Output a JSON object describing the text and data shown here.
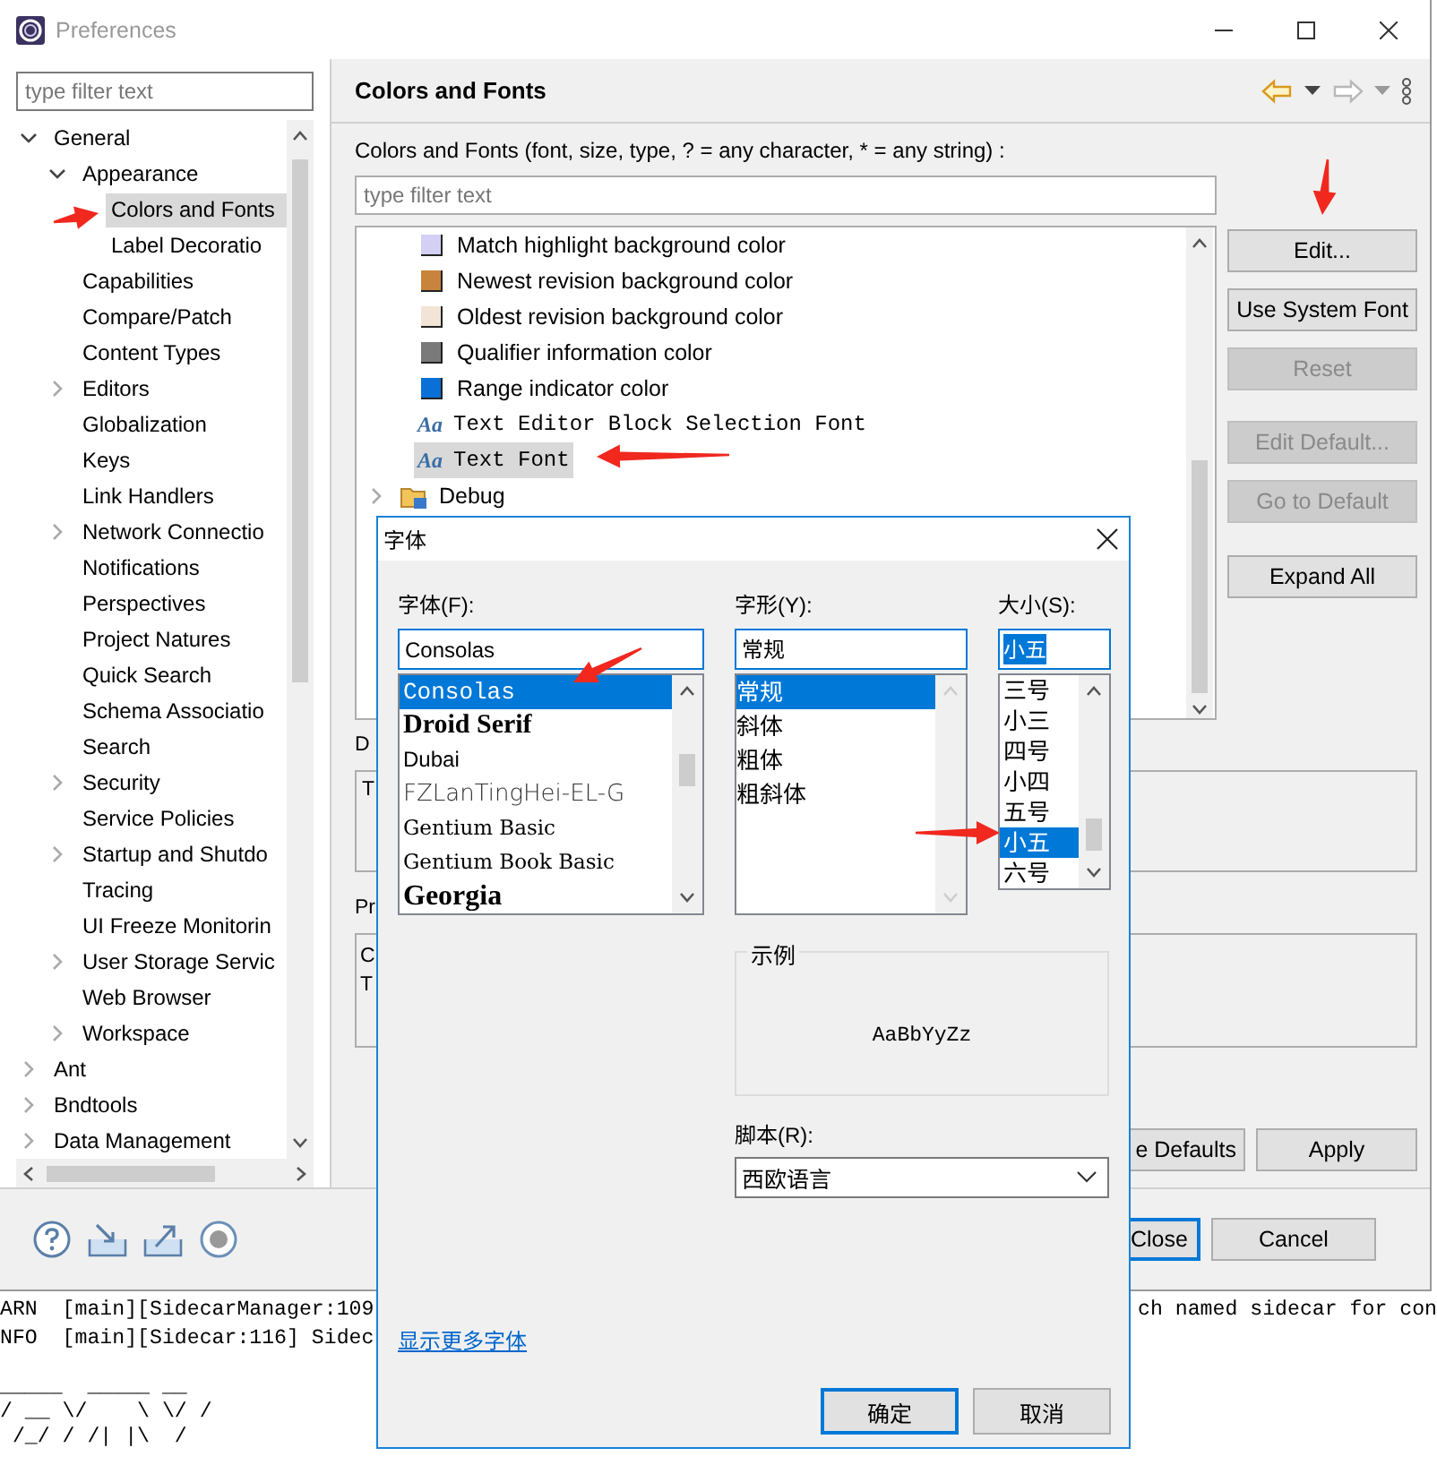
{
  "window": {
    "title": "Preferences"
  },
  "sidebar": {
    "filter": {
      "placeholder": "type filter text"
    },
    "tree": [
      {
        "label": "General",
        "expanded": true,
        "selected": false,
        "children": [
          {
            "label": "Appearance",
            "expanded": true,
            "selected": false,
            "children": [
              {
                "label": "Colors and Fonts",
                "selected": true
              },
              {
                "label": "Label Decoratio",
                "selected": false
              }
            ]
          },
          {
            "label": "Capabilities",
            "selected": false
          },
          {
            "label": "Compare/Patch",
            "selected": false
          },
          {
            "label": "Content Types",
            "selected": false
          },
          {
            "label": "Editors",
            "expanded": false,
            "selected": false
          },
          {
            "label": "Globalization",
            "selected": false
          },
          {
            "label": "Keys",
            "selected": false
          },
          {
            "label": "Link Handlers",
            "selected": false
          },
          {
            "label": "Network Connectio",
            "expanded": false,
            "selected": false
          },
          {
            "label": "Notifications",
            "selected": false
          },
          {
            "label": "Perspectives",
            "selected": false
          },
          {
            "label": "Project Natures",
            "selected": false
          },
          {
            "label": "Quick Search",
            "selected": false
          },
          {
            "label": "Schema Associatio",
            "selected": false
          },
          {
            "label": "Search",
            "selected": false
          },
          {
            "label": "Security",
            "expanded": false,
            "selected": false
          },
          {
            "label": "Service Policies",
            "selected": false
          },
          {
            "label": "Startup and Shutdo",
            "expanded": false,
            "selected": false
          },
          {
            "label": "Tracing",
            "selected": false
          },
          {
            "label": "UI Freeze Monitorin",
            "selected": false
          },
          {
            "label": "User Storage Servic",
            "expanded": false,
            "selected": false
          },
          {
            "label": "Web Browser",
            "selected": false
          },
          {
            "label": "Workspace",
            "expanded": false,
            "selected": false
          }
        ]
      },
      {
        "label": "Ant",
        "expanded": false,
        "selected": false
      },
      {
        "label": "Bndtools",
        "expanded": false,
        "selected": false
      },
      {
        "label": "Data Management",
        "expanded": false,
        "selected": false
      }
    ]
  },
  "page": {
    "title": "Colors and Fonts",
    "filter_label": "Colors and Fonts (font, size, type, ? = any character, * = any string) :",
    "filter": {
      "placeholder": "type filter text"
    },
    "items": [
      {
        "kind": "color",
        "label": "Match highlight background color",
        "color": "#d4d0f4",
        "selected": false
      },
      {
        "kind": "color",
        "label": "Newest revision background color",
        "color": "#c8843c",
        "selected": false
      },
      {
        "kind": "color",
        "label": "Oldest revision background color",
        "color": "#f2e4d6",
        "selected": false
      },
      {
        "kind": "color",
        "label": "Qualifier information color",
        "color": "#7a7a7a",
        "selected": false
      },
      {
        "kind": "color",
        "label": "Range indicator color",
        "color": "#0a6fd6",
        "selected": false
      },
      {
        "kind": "font",
        "icon": "Aa",
        "label": "Text Editor Block Selection Font",
        "selected": false
      },
      {
        "kind": "font",
        "icon": "Aa",
        "label": "Text Font",
        "selected": true
      },
      {
        "kind": "category",
        "label": "Debug",
        "expanded": false,
        "selected": false
      }
    ],
    "side_buttons": [
      {
        "label": "Edit...",
        "disabled": false
      },
      {
        "label": "Use System Font",
        "disabled": false
      },
      {
        "label": "Reset",
        "disabled": true
      },
      {
        "label": "Edit Default...",
        "disabled": true
      },
      {
        "label": "Go to Default",
        "disabled": true
      },
      {
        "label": "Expand All",
        "disabled": false
      }
    ],
    "description_label": "D",
    "description_text": "T",
    "preview_label": "Pr",
    "preview_lines": [
      "C",
      "T"
    ],
    "buttons": [
      {
        "label": "e Defaults"
      },
      {
        "label": "Apply"
      }
    ]
  },
  "footer": {
    "buttons": [
      {
        "label": "Close",
        "focused": true
      },
      {
        "label": "Cancel",
        "focused": false
      }
    ]
  },
  "console": {
    "lines": [
      {
        "left": "ARN  [main][SidecarManager:109",
        "right": "ch named sidecar for con"
      },
      {
        "left": "NFO  [main][Sidecar:116] Sidec"
      }
    ],
    "art": [
      "_____  _____ __",
      "/ __ \\/    \\ \\/ /",
      " /_/ / /| |\\  /"
    ]
  },
  "font_dialog": {
    "title": "字体",
    "font": {
      "label": "字体(F):",
      "value": "Consolas",
      "options": [
        {
          "label": "Consolas",
          "selected": true
        },
        {
          "label": "Droid Serif",
          "selected": false
        },
        {
          "label": "Dubai",
          "selected": false
        },
        {
          "label": "FZLanTingHei-EL-G",
          "selected": false
        },
        {
          "label": "Gentium Basic",
          "selected": false
        },
        {
          "label": "Gentium Book Basic",
          "selected": false
        },
        {
          "label": "Georgia",
          "selected": false
        }
      ]
    },
    "style": {
      "label": "字形(Y):",
      "value": "常规",
      "options": [
        {
          "label": "常规",
          "selected": true
        },
        {
          "label": "斜体",
          "selected": false
        },
        {
          "label": "粗体",
          "selected": false
        },
        {
          "label": "粗斜体",
          "selected": false
        }
      ]
    },
    "size": {
      "label": "大小(S):",
      "value": "小五",
      "options": [
        {
          "label": "三号",
          "selected": false
        },
        {
          "label": "小三",
          "selected": false
        },
        {
          "label": "四号",
          "selected": false
        },
        {
          "label": "小四",
          "selected": false
        },
        {
          "label": "五号",
          "selected": false
        },
        {
          "label": "小五",
          "selected": true
        },
        {
          "label": "六号",
          "selected": false
        }
      ]
    },
    "sample": {
      "label": "示例",
      "text": "AaBbYyZz"
    },
    "script": {
      "label": "脚本(R):",
      "value": "西欧语言"
    },
    "more_fonts_link": "显示更多字体",
    "buttons": [
      {
        "label": "确定",
        "focused": true
      },
      {
        "label": "取消",
        "focused": false
      }
    ]
  }
}
